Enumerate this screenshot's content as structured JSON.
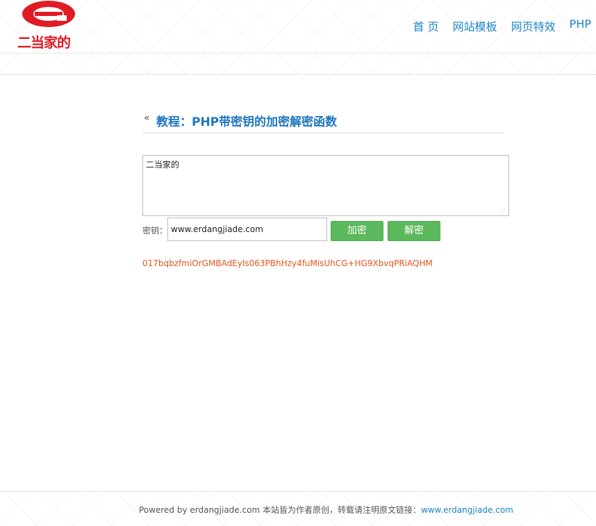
{
  "header": {
    "logo_text": "二当家的",
    "nav": [
      {
        "label": "首 页"
      },
      {
        "label": "网站模板"
      },
      {
        "label": "网页特效"
      },
      {
        "label": "PHP"
      }
    ]
  },
  "main": {
    "back_icon": "«",
    "title": "教程：PHP带密钥的加密解密函数",
    "plaintext_value": "二当家的",
    "key_label": "密钥：",
    "key_value": "www.erdangjiade.com",
    "encrypt_label": "加密",
    "decrypt_label": "解密",
    "result": "017bqbzfmiOrGMBAdEyIs063PBhHzy4fuMisUhCG+HG9XbvqPRiAQHM"
  },
  "footer": {
    "text": "Powered by erdangjiade.com 本站皆为作者原创，转载请注明原文链接：",
    "link": "www.erdangjiade.com"
  },
  "colors": {
    "brand_red": "#e01b24",
    "link_blue": "#1e84c6",
    "button_green": "#5cb85c",
    "result_orange": "#e8541e"
  }
}
